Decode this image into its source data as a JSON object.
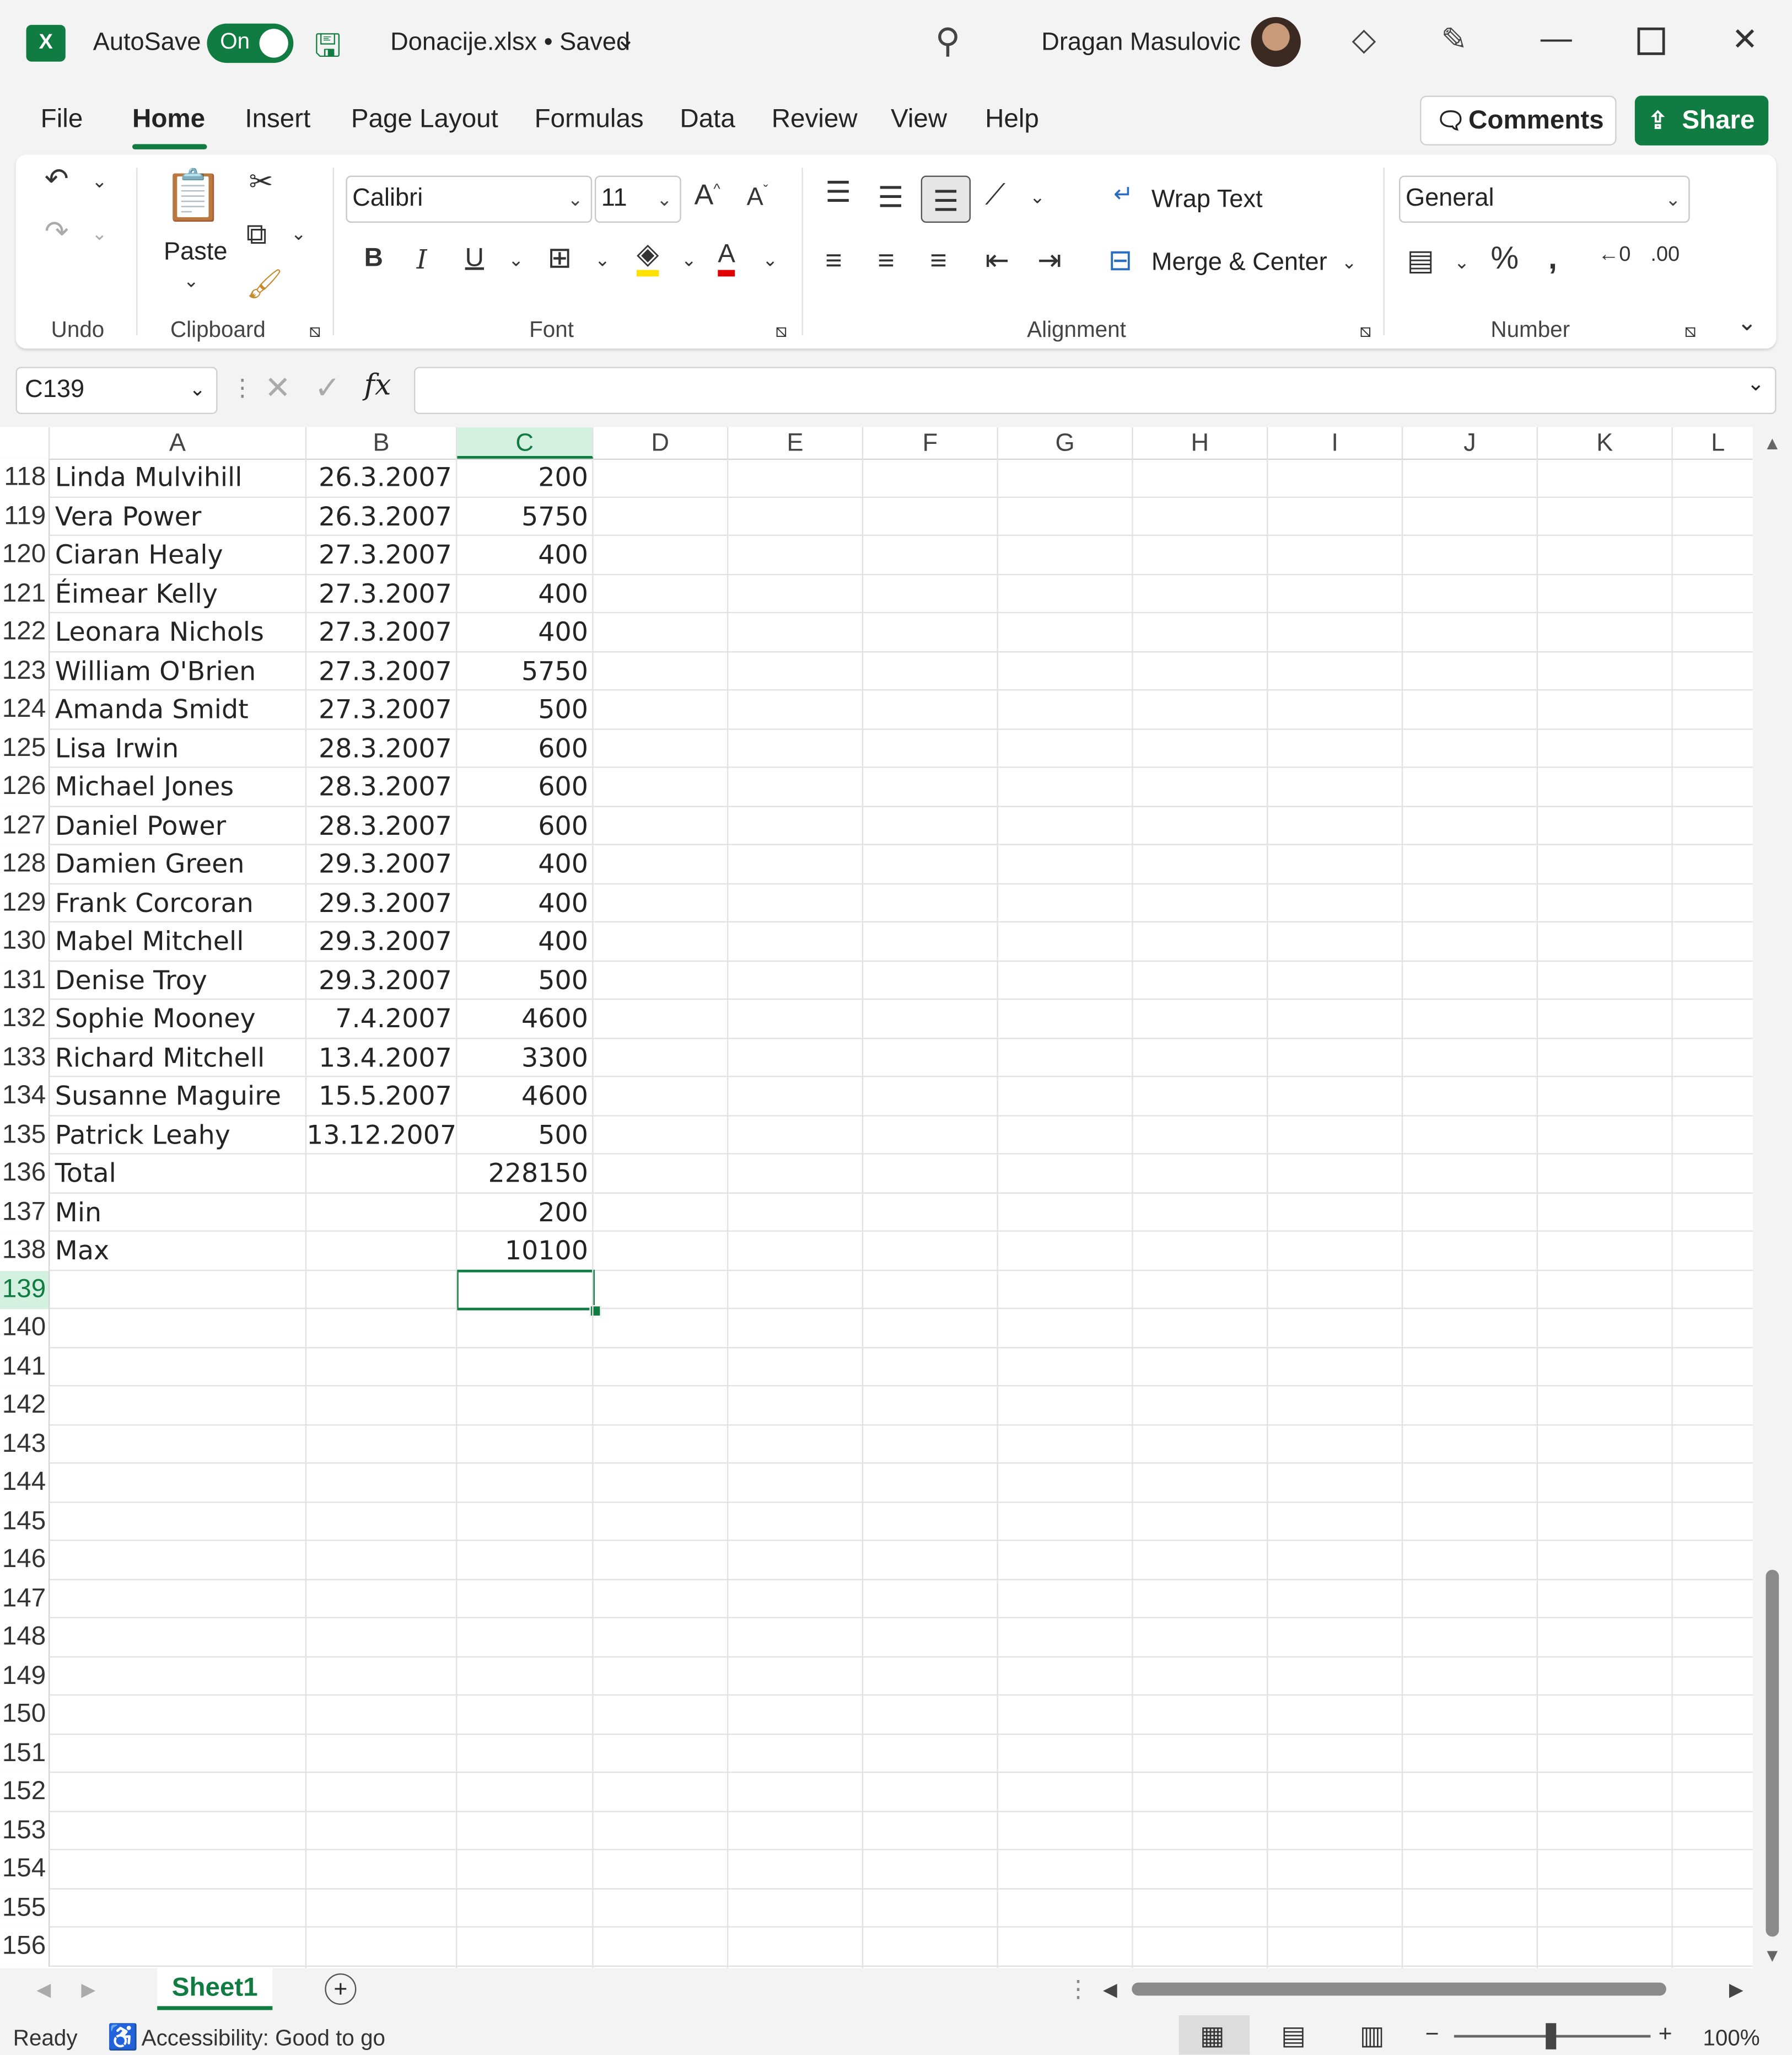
{
  "titlebar": {
    "app_letter": "X",
    "autosave_label": "AutoSave",
    "autosave_state": "On",
    "doc_title": "Donacije.xlsx • Saved",
    "user_name": "Dragan Masulovic"
  },
  "tabs": [
    "File",
    "Home",
    "Insert",
    "Page Layout",
    "Formulas",
    "Data",
    "Review",
    "View",
    "Help"
  ],
  "actions": {
    "comments": "Comments",
    "share": "Share"
  },
  "ribbon": {
    "groups": {
      "undo": "Undo",
      "clipboard": "Clipboard",
      "font": "Font",
      "alignment": "Alignment",
      "number": "Number"
    },
    "paste_label": "Paste",
    "font_name": "Calibri",
    "font_size": "11",
    "wrap_text": "Wrap Text",
    "merge_center": "Merge & Center",
    "number_format": "General"
  },
  "formula_bar": {
    "name_box": "C139",
    "fx": "fx",
    "value": ""
  },
  "grid": {
    "columns": [
      "A",
      "B",
      "C",
      "D",
      "E",
      "F",
      "G",
      "H",
      "I",
      "J",
      "K",
      "L"
    ],
    "selected_column": "C",
    "selected_row": "139",
    "rows": [
      {
        "n": "118",
        "a": "Linda Mulvihill",
        "b": "26.3.2007",
        "c": "200"
      },
      {
        "n": "119",
        "a": "Vera Power",
        "b": "26.3.2007",
        "c": "5750"
      },
      {
        "n": "120",
        "a": "Ciaran Healy",
        "b": "27.3.2007",
        "c": "400"
      },
      {
        "n": "121",
        "a": "Éimear Kelly",
        "b": "27.3.2007",
        "c": "400"
      },
      {
        "n": "122",
        "a": "Leonara Nichols",
        "b": "27.3.2007",
        "c": "400"
      },
      {
        "n": "123",
        "a": "William O'Brien",
        "b": "27.3.2007",
        "c": "5750"
      },
      {
        "n": "124",
        "a": "Amanda Smidt",
        "b": "27.3.2007",
        "c": "500"
      },
      {
        "n": "125",
        "a": "Lisa Irwin",
        "b": "28.3.2007",
        "c": "600"
      },
      {
        "n": "126",
        "a": "Michael Jones",
        "b": "28.3.2007",
        "c": "600"
      },
      {
        "n": "127",
        "a": "Daniel Power",
        "b": "28.3.2007",
        "c": "600"
      },
      {
        "n": "128",
        "a": "Damien Green",
        "b": "29.3.2007",
        "c": "400"
      },
      {
        "n": "129",
        "a": "Frank Corcoran",
        "b": "29.3.2007",
        "c": "400"
      },
      {
        "n": "130",
        "a": "Mabel Mitchell",
        "b": "29.3.2007",
        "c": "400"
      },
      {
        "n": "131",
        "a": "Denise Troy",
        "b": "29.3.2007",
        "c": "500"
      },
      {
        "n": "132",
        "a": "Sophie Mooney",
        "b": "7.4.2007",
        "c": "4600"
      },
      {
        "n": "133",
        "a": "Richard Mitchell",
        "b": "13.4.2007",
        "c": "3300"
      },
      {
        "n": "134",
        "a": "Susanne Maguire",
        "b": "15.5.2007",
        "c": "4600"
      },
      {
        "n": "135",
        "a": "Patrick Leahy",
        "b": "13.12.2007",
        "c": "500"
      },
      {
        "n": "136",
        "a": "Total",
        "b": "",
        "c": "228150"
      },
      {
        "n": "137",
        "a": "Min",
        "b": "",
        "c": "200"
      },
      {
        "n": "138",
        "a": "Max",
        "b": "",
        "c": "10100"
      },
      {
        "n": "139",
        "a": "",
        "b": "",
        "c": ""
      },
      {
        "n": "140",
        "a": "",
        "b": "",
        "c": ""
      },
      {
        "n": "141",
        "a": "",
        "b": "",
        "c": ""
      },
      {
        "n": "142",
        "a": "",
        "b": "",
        "c": ""
      },
      {
        "n": "143",
        "a": "",
        "b": "",
        "c": ""
      },
      {
        "n": "144",
        "a": "",
        "b": "",
        "c": ""
      },
      {
        "n": "145",
        "a": "",
        "b": "",
        "c": ""
      },
      {
        "n": "146",
        "a": "",
        "b": "",
        "c": ""
      },
      {
        "n": "147",
        "a": "",
        "b": "",
        "c": ""
      },
      {
        "n": "148",
        "a": "",
        "b": "",
        "c": ""
      },
      {
        "n": "149",
        "a": "",
        "b": "",
        "c": ""
      },
      {
        "n": "150",
        "a": "",
        "b": "",
        "c": ""
      },
      {
        "n": "151",
        "a": "",
        "b": "",
        "c": ""
      },
      {
        "n": "152",
        "a": "",
        "b": "",
        "c": ""
      },
      {
        "n": "153",
        "a": "",
        "b": "",
        "c": ""
      },
      {
        "n": "154",
        "a": "",
        "b": "",
        "c": ""
      },
      {
        "n": "155",
        "a": "",
        "b": "",
        "c": ""
      },
      {
        "n": "156",
        "a": "",
        "b": "",
        "c": ""
      }
    ]
  },
  "sheets": {
    "active": "Sheet1"
  },
  "status": {
    "ready": "Ready",
    "accessibility": "Accessibility: Good to go",
    "zoom": "100%"
  },
  "colors": {
    "accent": "#107c41"
  }
}
